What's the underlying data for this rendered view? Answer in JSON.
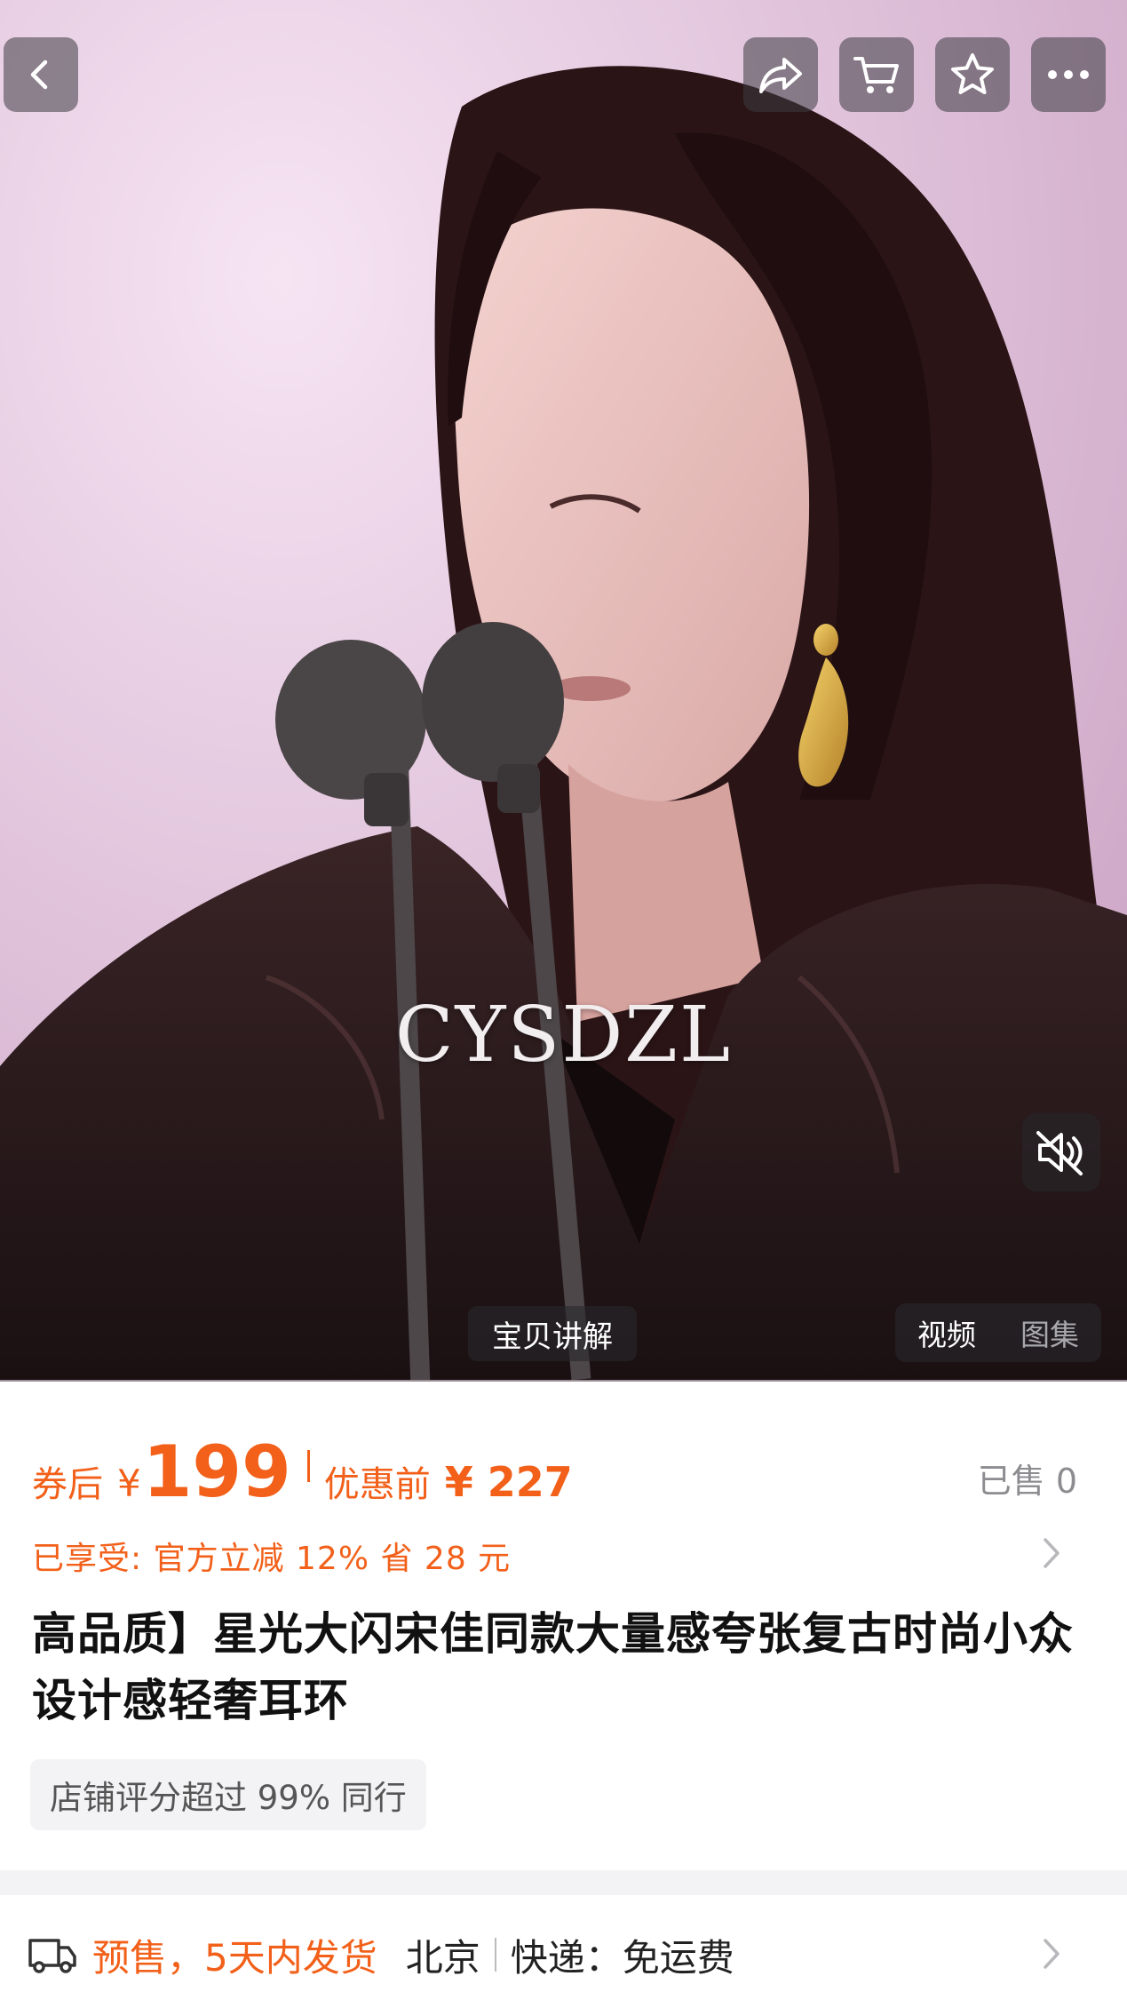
{
  "media": {
    "watermark": "CYSDZL",
    "explain_button": "宝贝讲解",
    "tabs": [
      "视频",
      "图集"
    ]
  },
  "top_actions": {
    "back": "back-icon",
    "share": "share-icon",
    "cart": "cart-icon",
    "favorite": "star-icon",
    "more": "more-icon"
  },
  "price": {
    "after_coupon_label": "券后",
    "currency": "¥",
    "after_coupon_price": "199",
    "before_label": "优惠前",
    "before_price": "¥ 227",
    "sold": "已售 0"
  },
  "discount_text": "已享受: 官方立减 12% 省 28 元",
  "product_title": "高品质】星光大闪宋佳同款大量感夸张复古时尚小众设计感轻奢耳环",
  "store_badge": "店铺评分超过 99% 同行",
  "shipping": {
    "presale": "预售，5天内发货",
    "city": "北京",
    "express": "快递：免运费"
  },
  "colors": {
    "accent": "#f2601a",
    "muted": "#8c8c91"
  }
}
